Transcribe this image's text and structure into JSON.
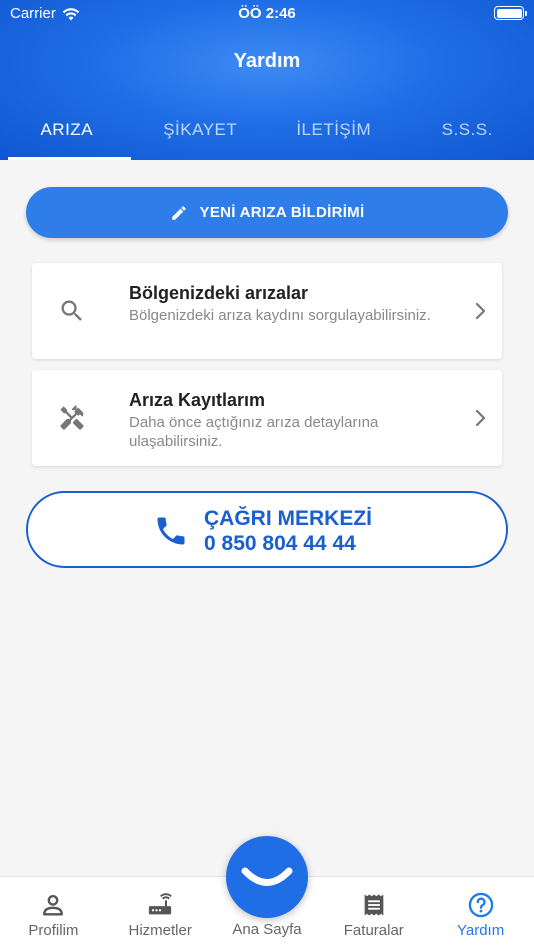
{
  "status_bar": {
    "carrier": "Carrier",
    "time": "ÖÖ 2:46"
  },
  "header": {
    "title": "Yardım"
  },
  "tabs": [
    {
      "label": "ARIZA",
      "active": true
    },
    {
      "label": "ŞİKAYET",
      "active": false
    },
    {
      "label": "İLETİŞİM",
      "active": false
    },
    {
      "label": "S.S.S.",
      "active": false
    }
  ],
  "new_fault_button": {
    "label": "YENİ ARIZA BİLDİRİMİ",
    "icon": "pencil-icon"
  },
  "cards": [
    {
      "title": "Bölgenizdeki arızalar",
      "description": "Bölgenizdeki arıza kaydını sorgulayabilirsiniz.",
      "icon": "search-icon"
    },
    {
      "title": "Arıza Kayıtlarım",
      "description": "Daha önce açtığınız arıza detaylarına ulaşabilirsiniz.",
      "icon": "tools-icon"
    }
  ],
  "call_center": {
    "label": "ÇAĞRI MERKEZİ",
    "phone": "0 850 804 44 44",
    "icon": "phone-icon"
  },
  "bottom_nav": {
    "items": [
      {
        "label": "Profilim",
        "icon": "person-icon",
        "active": false
      },
      {
        "label": "Hizmetler",
        "icon": "router-icon",
        "active": false
      },
      {
        "label": "Ana Sayfa",
        "icon": "smile-icon",
        "active": false
      },
      {
        "label": "Faturalar",
        "icon": "receipt-icon",
        "active": false
      },
      {
        "label": "Yardım",
        "icon": "help-icon",
        "active": true
      }
    ]
  },
  "colors": {
    "primary": "#1f6ee6",
    "button": "#2f7de9",
    "call_center": "#1a5fd0",
    "active_nav": "#1f7be8"
  }
}
